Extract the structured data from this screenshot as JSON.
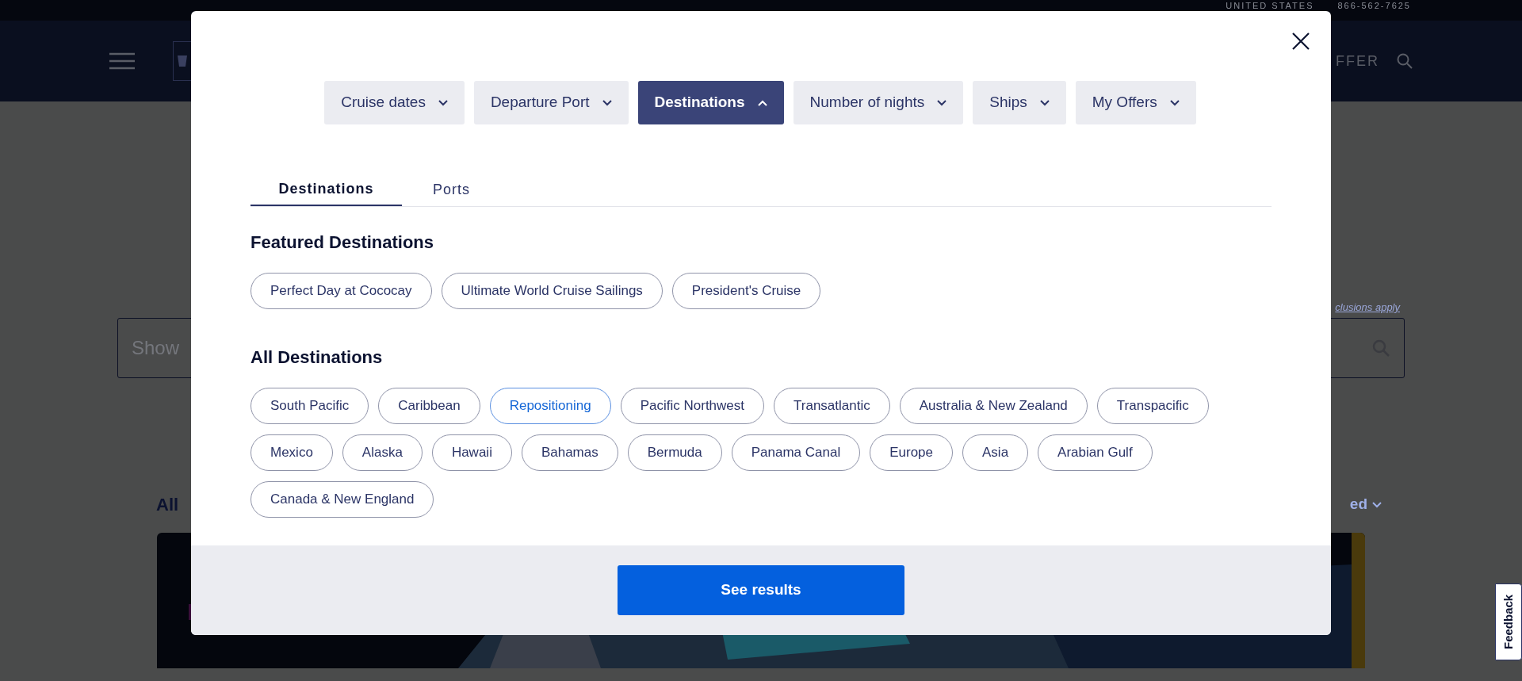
{
  "background": {
    "country": "UNITED STATES",
    "phone": "866-562-7625",
    "nav_cut": "FFER",
    "search_placeholder": "Show",
    "exclusions_link": "clusions apply",
    "section_heading": "All",
    "sort_cut": "ed"
  },
  "feedback_tab": "Feedback",
  "modal": {
    "filters": [
      {
        "label": "Cruise dates",
        "selected": false
      },
      {
        "label": "Departure Port",
        "selected": false
      },
      {
        "label": "Destinations",
        "selected": true
      },
      {
        "label": "Number of nights",
        "selected": false
      },
      {
        "label": "Ships",
        "selected": false
      },
      {
        "label": "My Offers",
        "selected": false
      }
    ],
    "tabs": [
      {
        "label": "Destinations",
        "selected": true
      },
      {
        "label": "Ports",
        "selected": false
      }
    ],
    "featured_heading": "Featured Destinations",
    "featured": [
      {
        "label": "Perfect Day at Cococay",
        "selected": false
      },
      {
        "label": "Ultimate World Cruise Sailings",
        "selected": false
      },
      {
        "label": "President's Cruise",
        "selected": false
      }
    ],
    "all_heading": "All Destinations",
    "all": [
      {
        "label": "South Pacific",
        "selected": false
      },
      {
        "label": "Caribbean",
        "selected": false
      },
      {
        "label": "Repositioning",
        "selected": true
      },
      {
        "label": "Pacific Northwest",
        "selected": false
      },
      {
        "label": "Transatlantic",
        "selected": false
      },
      {
        "label": "Australia & New Zealand",
        "selected": false
      },
      {
        "label": "Transpacific",
        "selected": false
      },
      {
        "label": "Mexico",
        "selected": false
      },
      {
        "label": "Alaska",
        "selected": false
      },
      {
        "label": "Hawaii",
        "selected": false
      },
      {
        "label": "Bahamas",
        "selected": false
      },
      {
        "label": "Bermuda",
        "selected": false
      },
      {
        "label": "Panama Canal",
        "selected": false
      },
      {
        "label": "Europe",
        "selected": false
      },
      {
        "label": "Asia",
        "selected": false
      },
      {
        "label": "Arabian Gulf",
        "selected": false
      },
      {
        "label": "Canada & New England",
        "selected": false
      }
    ],
    "submit": "See results"
  }
}
